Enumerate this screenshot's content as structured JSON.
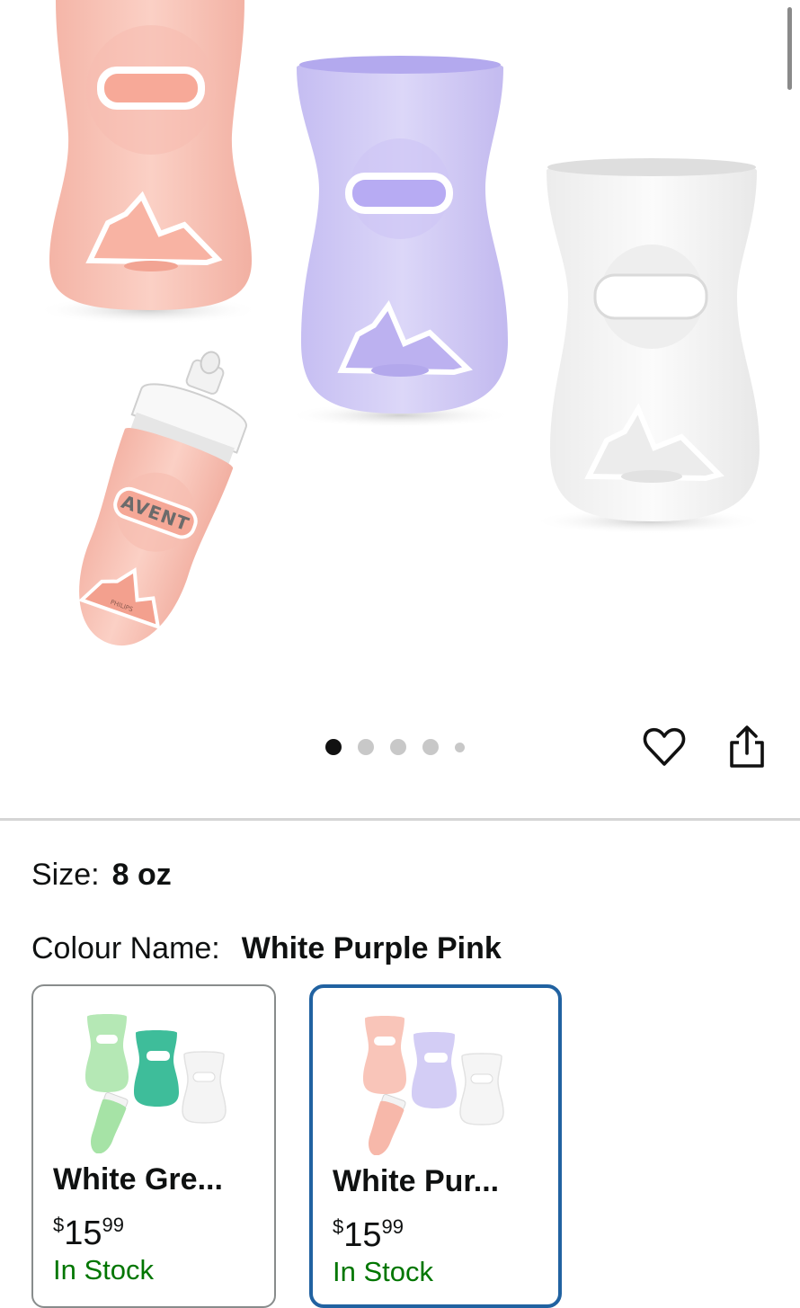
{
  "gallery": {
    "image_alt": "Silicone bottle sleeves in pink, purple and white with a pink-sleeved AVENT bottle",
    "bottle_brand_text": "AVENT",
    "bottle_maker_text": "PHILIPS",
    "dot_count": 5,
    "active_index": 0
  },
  "actions": {
    "favorite_icon": "heart-icon",
    "share_icon": "share-icon"
  },
  "options": {
    "size_label": "Size:",
    "size_value": "8 oz",
    "colour_label": "Colour Name:",
    "colour_value": "White Purple Pink"
  },
  "swatches": [
    {
      "name": "White Gre...",
      "currency": "$",
      "price_whole": "15",
      "price_cents": "99",
      "stock": "In Stock"
    },
    {
      "name": "White Pur...",
      "currency": "$",
      "price_whole": "15",
      "price_cents": "99",
      "stock": "In Stock"
    }
  ],
  "colors": {
    "accent_selected": "#2162a1",
    "in_stock": "#007600",
    "sleeve_pink": "#f9c5b9",
    "sleeve_purple": "#d3cdf5",
    "sleeve_white": "#f5f5f5",
    "sleeve_green_light": "#b5e8b5",
    "sleeve_teal": "#3ebd9a"
  }
}
